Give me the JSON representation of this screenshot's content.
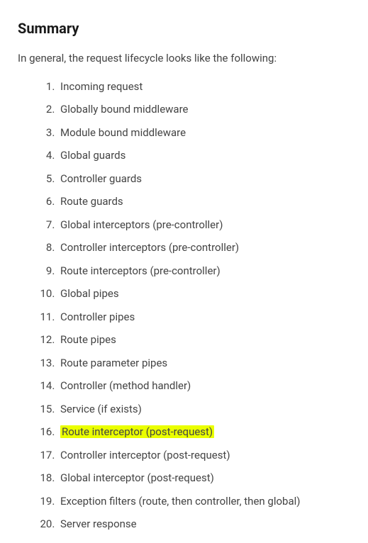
{
  "heading": "Summary",
  "intro": "In general, the request lifecycle looks like the following:",
  "items": [
    {
      "text": "Incoming request",
      "highlight": false
    },
    {
      "text": "Globally bound middleware",
      "highlight": false
    },
    {
      "text": "Module bound middleware",
      "highlight": false
    },
    {
      "text": "Global guards",
      "highlight": false
    },
    {
      "text": "Controller guards",
      "highlight": false
    },
    {
      "text": "Route guards",
      "highlight": false
    },
    {
      "text": "Global interceptors (pre-controller)",
      "highlight": false
    },
    {
      "text": "Controller interceptors (pre-controller)",
      "highlight": false
    },
    {
      "text": "Route interceptors (pre-controller)",
      "highlight": false
    },
    {
      "text": "Global pipes",
      "highlight": false
    },
    {
      "text": "Controller pipes",
      "highlight": false
    },
    {
      "text": "Route pipes",
      "highlight": false
    },
    {
      "text": "Route parameter pipes",
      "highlight": false
    },
    {
      "text": "Controller (method handler)",
      "highlight": false
    },
    {
      "text": "Service (if exists)",
      "highlight": false
    },
    {
      "text": "Route interceptor (post-request)",
      "highlight": true
    },
    {
      "text": "Controller interceptor (post-request)",
      "highlight": false
    },
    {
      "text": "Global interceptor (post-request)",
      "highlight": false
    },
    {
      "text": "Exception filters (route, then controller, then global)",
      "highlight": false
    },
    {
      "text": "Server response",
      "highlight": false
    }
  ]
}
